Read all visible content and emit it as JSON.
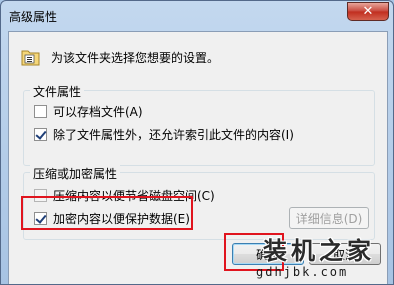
{
  "window": {
    "title": "高级属性",
    "close_symbol": "✕"
  },
  "header": {
    "icon": "folder-properties-icon",
    "description": "为该文件夹选择您想要的设置。"
  },
  "file_attributes": {
    "group_title": "文件属性",
    "archive": {
      "label": "可以存档文件(A)",
      "checked": false
    },
    "index": {
      "label": "除了文件属性外，还允许索引此文件的内容(I)",
      "checked": true
    }
  },
  "compress_encrypt": {
    "group_title": "压缩或加密属性",
    "compress": {
      "label": "压缩内容以便节省磁盘空间(C)",
      "checked": false,
      "enabled": false
    },
    "encrypt": {
      "label": "加密内容以便保护数据(E)",
      "checked": true
    },
    "details_button": "详细信息(D)"
  },
  "buttons": {
    "ok": "确定",
    "cancel": "取消"
  },
  "watermark": {
    "logo": "装机之家",
    "url": "gdhjbk.com"
  },
  "colors": {
    "highlight_box": "#e0141e",
    "title_bar": "#b7d0ec",
    "close_button": "#c7463a"
  }
}
